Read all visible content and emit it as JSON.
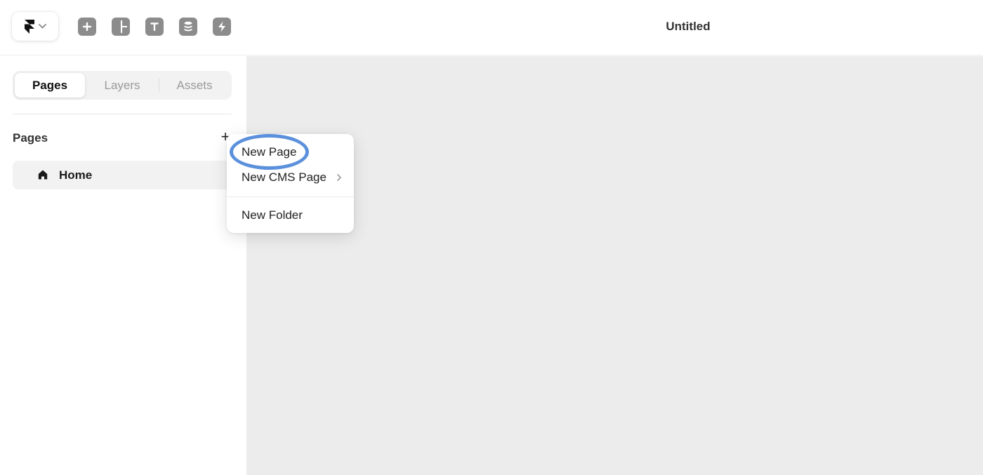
{
  "header": {
    "title": "Untitled",
    "logo_icon": "framer-logo-icon",
    "tools": [
      {
        "icon": "insert-icon"
      },
      {
        "icon": "layout-icon"
      },
      {
        "icon": "text-icon"
      },
      {
        "icon": "cms-icon"
      },
      {
        "icon": "interactions-icon"
      }
    ]
  },
  "sidebar": {
    "tabs": [
      {
        "label": "Pages",
        "active": true
      },
      {
        "label": "Layers",
        "active": false
      },
      {
        "label": "Assets",
        "active": false
      }
    ],
    "section_title": "Pages",
    "add_label": "+",
    "pages": [
      {
        "label": "Home",
        "icon": "home-icon"
      }
    ]
  },
  "context_menu": {
    "items": [
      {
        "label": "New Page",
        "highlighted": true
      },
      {
        "label": "New CMS Page",
        "has_submenu": true
      },
      {
        "label": "New Folder"
      }
    ]
  },
  "colors": {
    "accent_highlight": "#5b90dc",
    "canvas_bg": "#ececec",
    "tool_icon": "#8c8c8c"
  }
}
